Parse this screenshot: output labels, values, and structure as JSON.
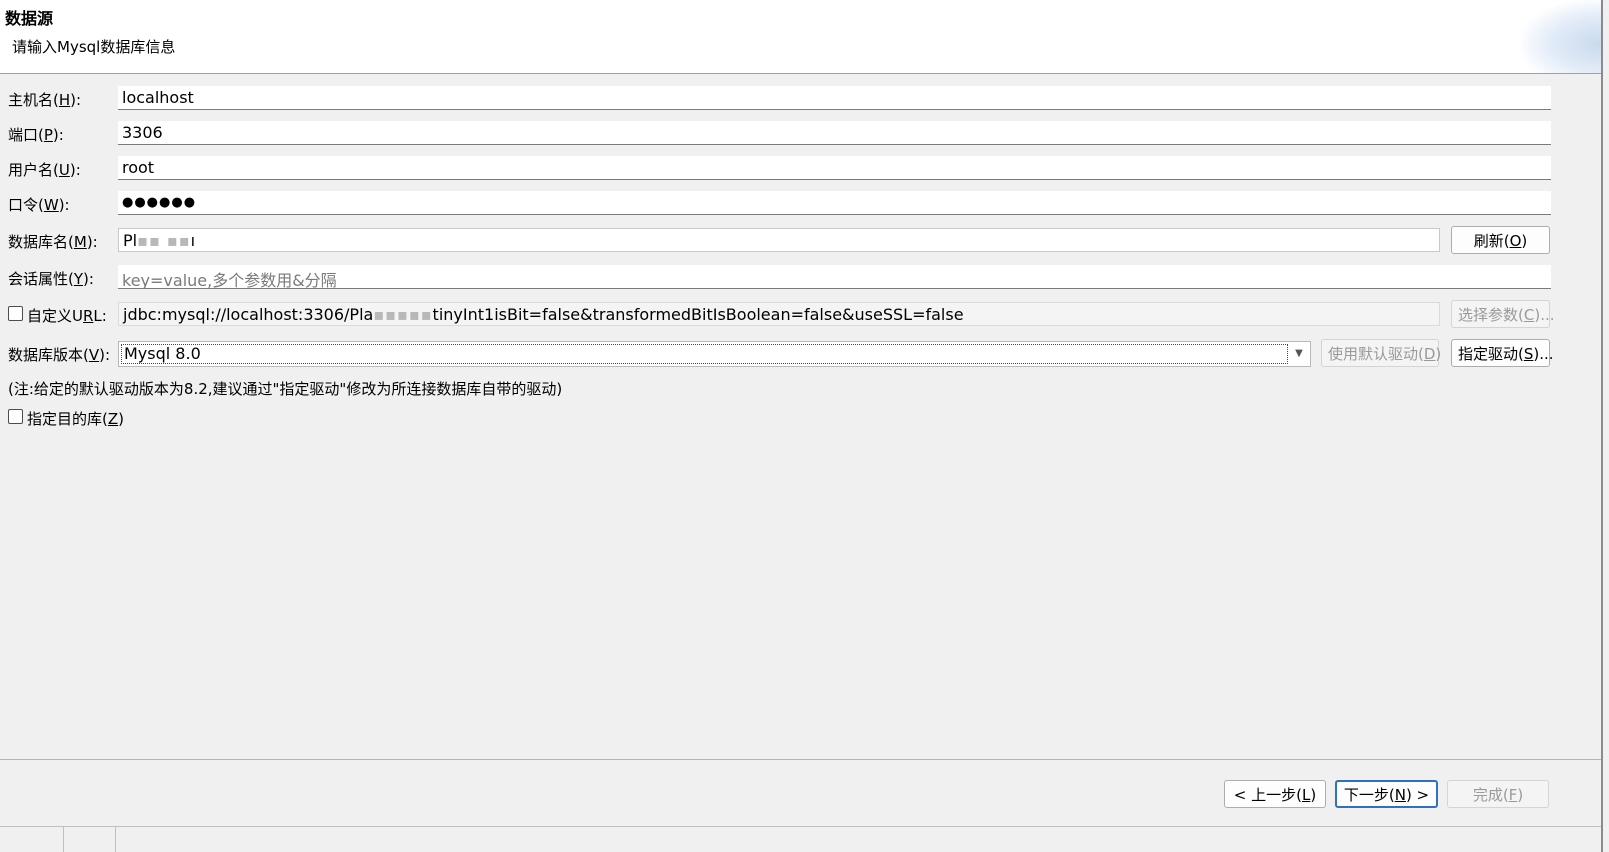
{
  "header": {
    "title": "数据源",
    "description": "请输入Mysql数据库信息"
  },
  "fields": {
    "host": {
      "label_pre": "主机名(",
      "mnemonic": "H",
      "label_post": "):",
      "value": "localhost"
    },
    "port": {
      "label_pre": "端口(",
      "mnemonic": "P",
      "label_post": "):",
      "value": "3306"
    },
    "user": {
      "label_pre": "用户名(",
      "mnemonic": "U",
      "label_post": "):",
      "value": "root"
    },
    "password": {
      "label_pre": "口令(",
      "mnemonic": "W",
      "label_post": "):",
      "value": "●●●●●●"
    },
    "database": {
      "label_pre": "数据库名(",
      "mnemonic": "M",
      "label_post": "):",
      "value_visible": "Pl",
      "value_blur": "▪▪ ▪▪",
      "value_tail": "ı"
    },
    "session": {
      "label_pre": "会话属性(",
      "mnemonic": "Y",
      "label_post": "):",
      "placeholder": "key=value,多个参数用&分隔"
    },
    "url": {
      "label_pre": "自定义U",
      "mnemonic": "R",
      "label_post": "L:",
      "checked": false,
      "value_head": "jdbc:mysql://localhost:3306/Pla",
      "value_blur": "▪▪▪▪▪",
      "value_tail": "tinyInt1isBit=false&transformedBitIsBoolean=false&useSSL=false"
    },
    "version": {
      "label_pre": "数据库版本(",
      "mnemonic": "V",
      "label_post": "):",
      "selected": "Mysql 8.0"
    }
  },
  "buttons": {
    "refresh": {
      "pre": "刷新(",
      "mnemonic": "O",
      "post": ")"
    },
    "select_params": {
      "pre": "选择参数(",
      "mnemonic": "C",
      "post": ")..."
    },
    "default_driver": {
      "pre": "使用默认驱动(",
      "mnemonic": "D",
      "post": ")"
    },
    "specify_driver": {
      "pre": "指定驱动(",
      "mnemonic": "S",
      "post": ")..."
    },
    "back": {
      "pre": "< 上一步(",
      "mnemonic": "L",
      "post": ")"
    },
    "next": {
      "pre": "下一步(",
      "mnemonic": "N",
      "post": ") >"
    },
    "finish": {
      "pre": "完成(",
      "mnemonic": "F",
      "post": ")"
    }
  },
  "note": "(注:给定的默认驱动版本为8.2,建议通过\"指定驱动\"修改为所连接数据库自带的驱动)",
  "target_db": {
    "label_pre": "指定目的库(",
    "mnemonic": "Z",
    "label_post": ")",
    "checked": false
  },
  "icons": {
    "dropdown": "chevron-down-icon"
  },
  "colors": {
    "accent": "#2f6fc4",
    "header_bg": "#ffffff",
    "body_bg": "#f0f0f0"
  }
}
